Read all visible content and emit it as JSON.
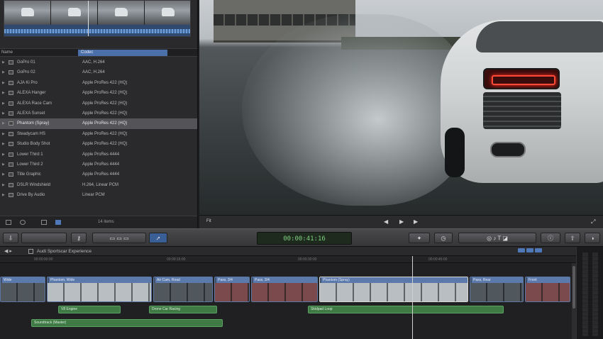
{
  "browser": {
    "header": {
      "name": "Name",
      "codec": "Codec"
    },
    "clips": [
      {
        "name": "GoPro 01",
        "codec": "AAC, H.264",
        "selected": false
      },
      {
        "name": "GoPro 02",
        "codec": "AAC, H.264",
        "selected": false
      },
      {
        "name": "AJA Ki Pro",
        "codec": "Apple ProRes 422 (HQ)",
        "selected": false
      },
      {
        "name": "ALEXA Hanger",
        "codec": "Apple ProRes 422 (HQ)",
        "selected": false
      },
      {
        "name": "ALEXA Race Cam",
        "codec": "Apple ProRes 422 (HQ)",
        "selected": false
      },
      {
        "name": "ALEXA Sunset",
        "codec": "Apple ProRes 422 (HQ)",
        "selected": false
      },
      {
        "name": "Phantom (Spray)",
        "codec": "Apple ProRes 422 (HQ)",
        "selected": true
      },
      {
        "name": "Steadycam HS",
        "codec": "Apple ProRes 422 (HQ)",
        "selected": false
      },
      {
        "name": "Studio Body Shot",
        "codec": "Apple ProRes 422 (HQ)",
        "selected": false
      },
      {
        "name": "Lower Third 1",
        "codec": "Apple ProRes 4444",
        "selected": false
      },
      {
        "name": "Lower Third 2",
        "codec": "Apple ProRes 4444",
        "selected": false
      },
      {
        "name": "Title Graphic",
        "codec": "Apple ProRes 4444",
        "selected": false
      },
      {
        "name": "DSLR Windshield",
        "codec": "H.264, Linear PCM",
        "selected": false
      },
      {
        "name": "Drive By Audio",
        "codec": "Linear PCM",
        "selected": false
      }
    ],
    "footer": {
      "count": "14 items"
    }
  },
  "viewer": {
    "zoom_label": "Fit"
  },
  "toolbar": {
    "timecode": "00:00:41:16"
  },
  "timeline": {
    "project_name": "Audi Sportscar Experience",
    "ruler": [
      "00:00:00:00",
      "00:00:15:00",
      "00:00:30:00",
      "00:00:45:00"
    ],
    "clips": [
      {
        "label": "Wide",
        "style": "dark"
      },
      {
        "label": "Phantom, Wide",
        "style": "bright"
      },
      {
        "label": "Air Cam, Road",
        "style": "dark"
      },
      {
        "label": "Pass, 3/4",
        "style": "red"
      },
      {
        "label": "Pass, 3/4",
        "style": "red"
      },
      {
        "label": "Phantom (Spray)",
        "style": "bright",
        "selected": true
      },
      {
        "label": "Pass, Rear",
        "style": "dark"
      },
      {
        "label": "Front",
        "style": "red"
      }
    ],
    "audio": [
      {
        "label": "V8 Engine"
      },
      {
        "label": "Drone Car Racing"
      },
      {
        "label": "Skidpad Loop"
      },
      {
        "label": "Soundtrack (Master)"
      }
    ]
  },
  "colors": {
    "accent": "#4b6fa8",
    "timecode": "#7fd07f",
    "clip_blue": "#5b79ab",
    "audio_green": "#3f7a45"
  }
}
